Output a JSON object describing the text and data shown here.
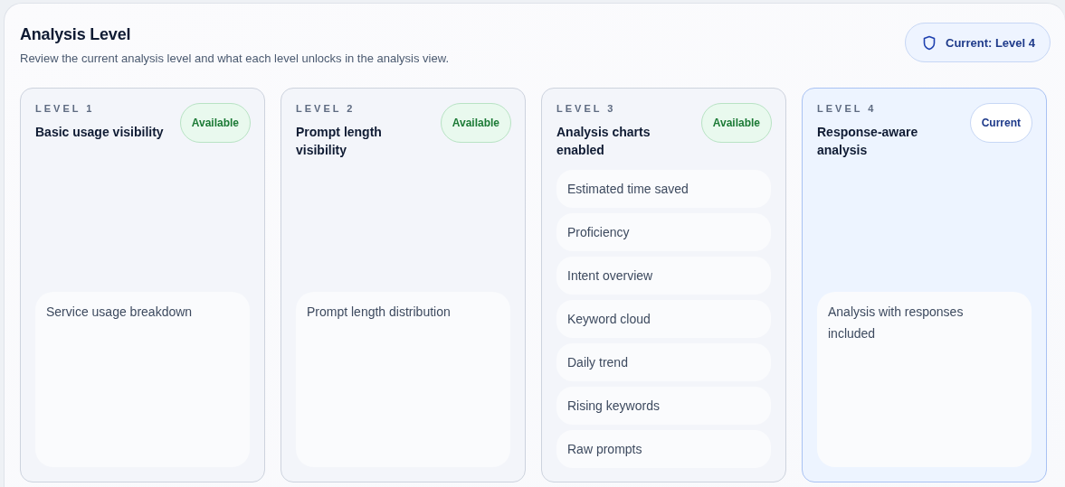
{
  "header": {
    "title": "Analysis Level",
    "subtitle": "Review the current analysis level and what each level unlocks in the analysis view.",
    "current_badge": "Current: Level 4"
  },
  "levels": [
    {
      "eyebrow": "LEVEL 1",
      "title": "Basic usage visibility",
      "kind": "available",
      "badge": "Available",
      "selected": false,
      "features": [
        "Service usage breakdown"
      ]
    },
    {
      "eyebrow": "LEVEL 2",
      "title": "Prompt length visibility",
      "kind": "available",
      "badge": "Available",
      "selected": false,
      "features": [
        "Prompt length distribution"
      ]
    },
    {
      "eyebrow": "LEVEL 3",
      "title": "Analysis charts enabled",
      "kind": "available",
      "badge": "Available",
      "selected": false,
      "features": [
        "Estimated time saved",
        "Proficiency",
        "Intent overview",
        "Keyword cloud",
        "Daily trend",
        "Rising keywords",
        "Raw prompts"
      ]
    },
    {
      "eyebrow": "LEVEL 4",
      "title": "Response-aware analysis",
      "kind": "current",
      "badge": "Current",
      "selected": true,
      "features": [
        "Analysis with responses included"
      ]
    }
  ]
}
